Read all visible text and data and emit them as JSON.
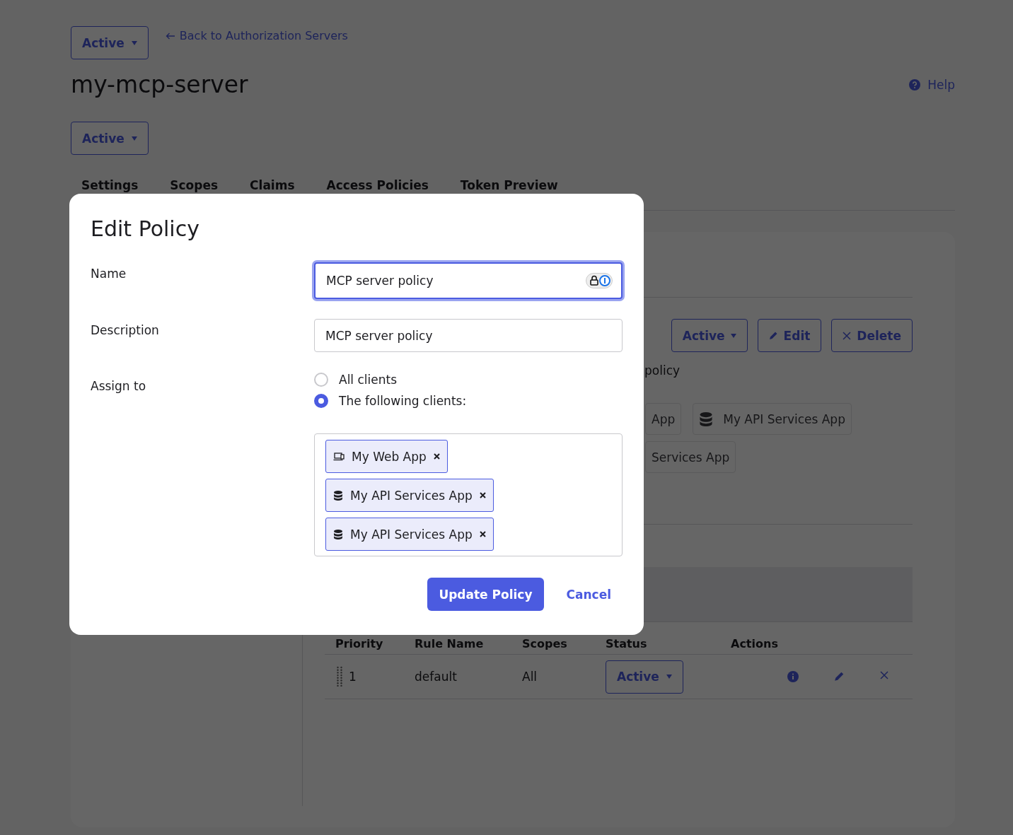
{
  "header": {
    "status_dropdown": {
      "label": "Active"
    },
    "back_link": "Back to Authorization Servers",
    "title": "my-mcp-server",
    "help_link": "Help",
    "server_status_dropdown": {
      "label": "Active"
    }
  },
  "tabs": [
    {
      "label": "Settings"
    },
    {
      "label": "Scopes"
    },
    {
      "label": "Claims"
    },
    {
      "label": "Access Policies"
    },
    {
      "label": "Token Preview"
    }
  ],
  "policy_panel": {
    "status_dropdown": {
      "label": "Active"
    },
    "edit_button": "Edit",
    "delete_button": "Delete",
    "description_fragment": "policy",
    "client_rows": [
      [
        {
          "label": "App"
        },
        {
          "label": "My API Services App",
          "kind": "api"
        }
      ],
      [
        {
          "label": "Services App"
        }
      ]
    ]
  },
  "rules_table": {
    "columns": [
      "Priority",
      "Rule Name",
      "Scopes",
      "Status",
      "Actions"
    ],
    "rows": [
      {
        "priority": "1",
        "rule_name": "default",
        "scopes": "All",
        "status": "Active"
      }
    ]
  },
  "modal": {
    "title": "Edit Policy",
    "name": {
      "label": "Name",
      "value": "MCP server policy",
      "focused": true
    },
    "description": {
      "label": "Description",
      "value": "MCP server policy"
    },
    "assign_to": {
      "label": "Assign to",
      "options": [
        {
          "label": "All clients",
          "selected": false
        },
        {
          "label": "The following clients:",
          "selected": true
        }
      ],
      "clients": [
        {
          "label": "My Web App",
          "kind": "web"
        },
        {
          "label": "My API Services App",
          "kind": "api"
        },
        {
          "label": "My API Services App",
          "kind": "api"
        }
      ]
    },
    "primary_button": "Update Policy",
    "cancel_button": "Cancel"
  }
}
